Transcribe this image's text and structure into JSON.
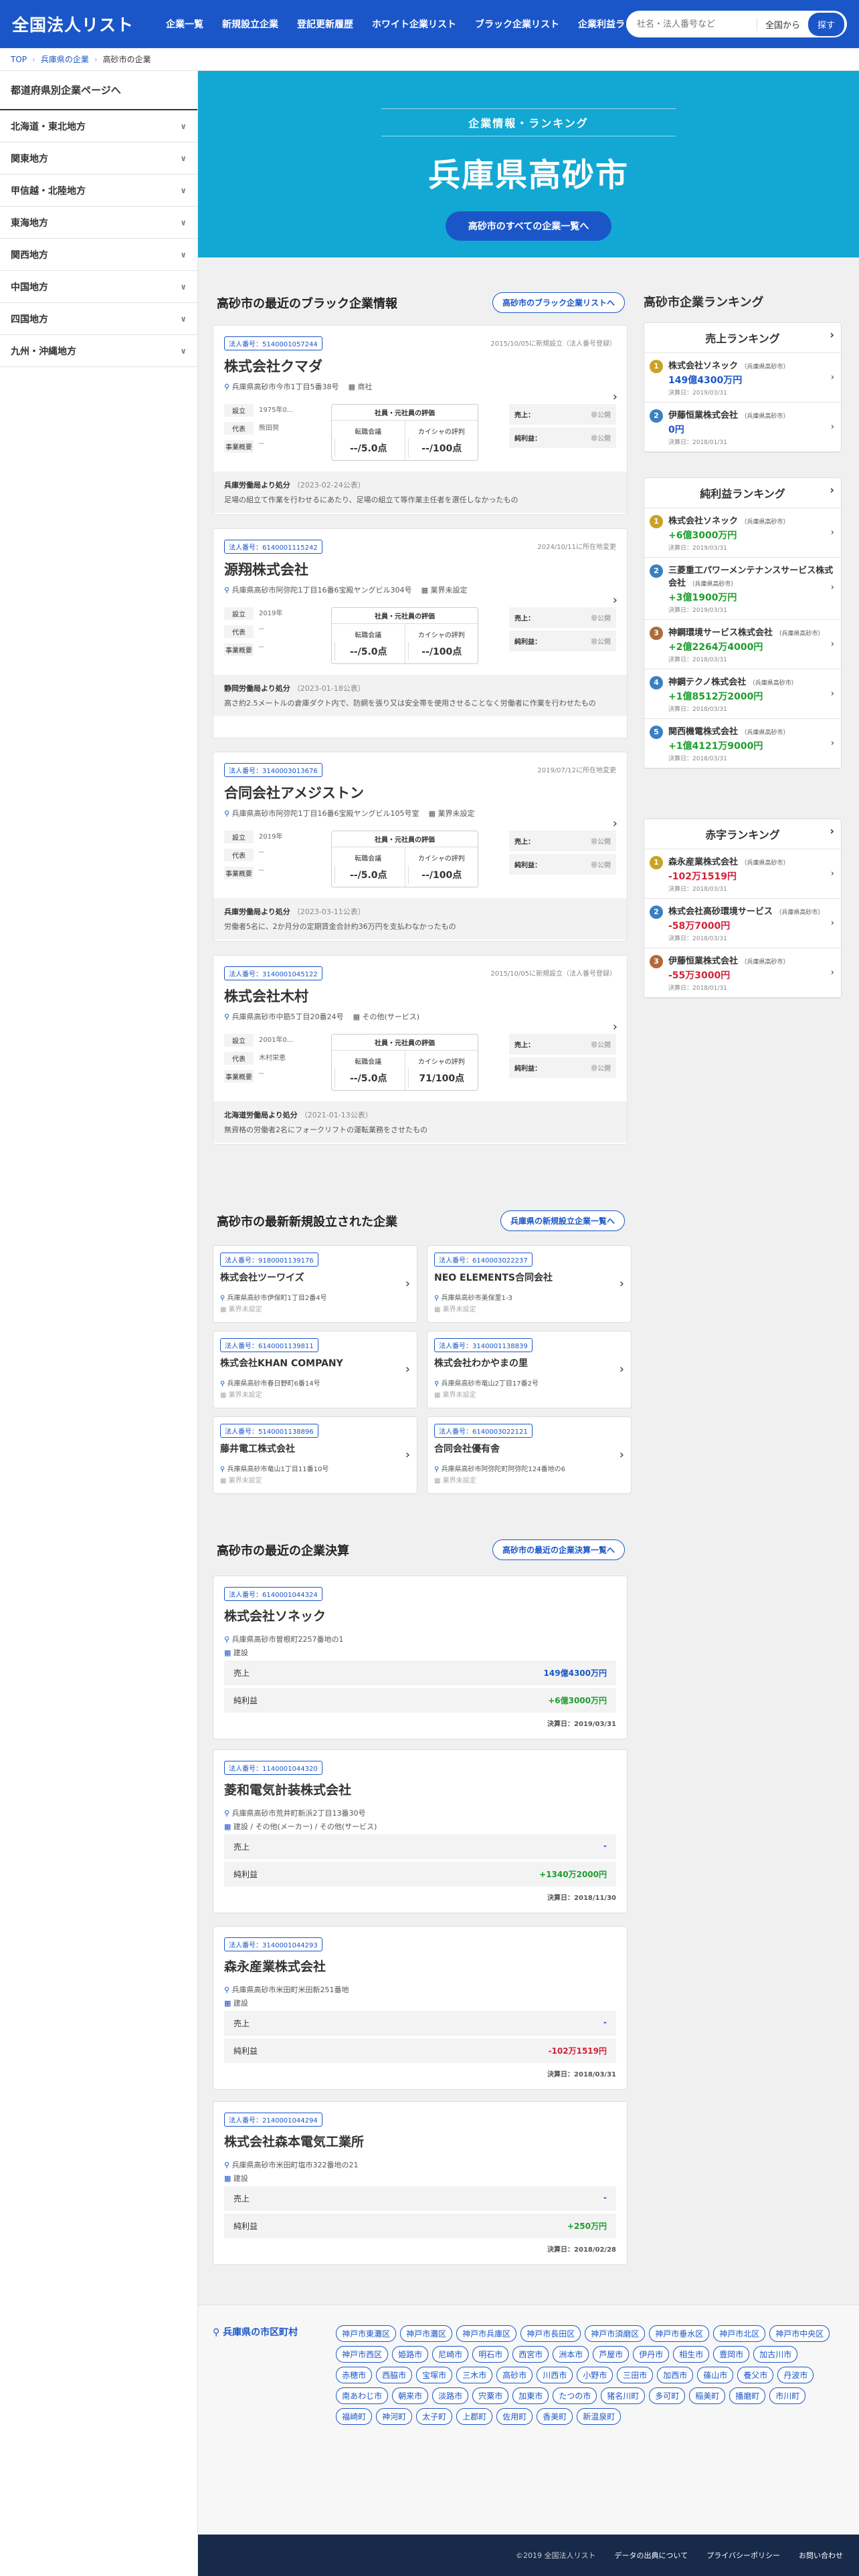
{
  "header": {
    "logo": "全国法人リスト",
    "nav": [
      "企業一覧",
      "新規設立企業",
      "登記更新履歴",
      "ホワイト企業リスト",
      "ブラック企業リスト",
      "企業利益ランキング"
    ],
    "search_placeholder": "社名・法人番号など",
    "search_scope": "全国から",
    "search_button": "探す"
  },
  "breadcrumb": [
    "TOP",
    "兵庫県の企業",
    "高砂市の企業"
  ],
  "sidebar": {
    "title": "都道府県別企業ページへ",
    "regions": [
      "北海道・東北地方",
      "関東地方",
      "甲信越・北陸地方",
      "東海地方",
      "関西地方",
      "中国地方",
      "四国地方",
      "九州・沖縄地方"
    ]
  },
  "hero": {
    "sub": "企業情報・ランキング",
    "title": "兵庫県高砂市",
    "button": "高砂市のすべての企業一覧へ"
  },
  "black": {
    "title": "高砂市の最近のブラック企業情報",
    "link": "高砂市のブラック企業リストへ",
    "labels": {
      "est": "設立",
      "rep": "代表",
      "biz": "事業概要",
      "eval": "社員・元社員の評価",
      "site1": "転職会議",
      "site2": "カイシャの評判",
      "sales": "売上：",
      "profit": "純利益：",
      "undisclosed": "非公開",
      "from": "より処分"
    },
    "items": [
      {
        "num": "法人番号：5140001057244",
        "date": "2015/10/05に新規設立（法人番号登録）",
        "name": "株式会社クマダ",
        "addr": "兵庫県高砂市今市1丁目5番38号",
        "ind": "商社",
        "est": "1975年0...",
        "rep": "熊田努",
        "biz": "--",
        "s1": "--/5.0点",
        "s2": "--/100点",
        "office": "兵庫労働局",
        "odate": "（2023-02-24公表）",
        "text": "足場の組立て作業を行わせるにあたり、足場の組立て等作業主任者を選任しなかったもの"
      },
      {
        "num": "法人番号：6140001115242",
        "date": "2024/10/11に所在地変更",
        "name": "源翔株式会社",
        "addr": "兵庫県高砂市阿弥陀1丁目16番6宝殿ヤングビル304号",
        "ind": "業界未設定",
        "est": "2019年",
        "rep": "--",
        "biz": "--",
        "s1": "--/5.0点",
        "s2": "--/100点",
        "office": "静岡労働局",
        "odate": "（2023-01-18公表）",
        "text": "高さ約2.5メートルの倉庫ダクト内で、防網を張り又は安全帯を使用させることなく労働者に作業を行わせたもの"
      },
      {
        "num": "法人番号：3140003013676",
        "date": "2019/07/12に所在地変更",
        "name": "合同会社アメジストン",
        "addr": "兵庫県高砂市阿弥陀1丁目16番6宝殿ヤングビル105号室",
        "ind": "業界未設定",
        "est": "2019年",
        "rep": "--",
        "biz": "--",
        "s1": "--/5.0点",
        "s2": "--/100点",
        "office": "兵庫労働局",
        "odate": "（2023-03-11公表）",
        "text": "労働者5名に、2か月分の定期賃金合計約36万円を支払わなかったもの"
      },
      {
        "num": "法人番号：3140001045122",
        "date": "2015/10/05に新規設立（法人番号登録）",
        "name": "株式会社木村",
        "addr": "兵庫県高砂市中筋5丁目20番24号",
        "ind": "その他(サービス)",
        "est": "2001年0...",
        "rep": "木村栄恵",
        "biz": "--",
        "s1": "--/5.0点",
        "s2": "71/100点",
        "office": "北海道労働局",
        "odate": "（2021-01-13公表）",
        "text": "無資格の労働者2名にフォークリフトの運転業務をさせたもの"
      }
    ]
  },
  "new": {
    "title": "高砂市の最新新規設立された企業",
    "link": "兵庫県の新規設立企業一覧へ",
    "items": [
      {
        "num": "法人番号：9180001139176",
        "name": "株式会社ツーワイズ",
        "addr": "兵庫県高砂市伊保町1丁目2番4号",
        "ind": "業界未設定"
      },
      {
        "num": "法人番号：6140003022237",
        "name": "NEO ELEMENTS合同会社",
        "addr": "兵庫県高砂市美保里1-3",
        "ind": "業界未設定"
      },
      {
        "num": "法人番号：6140001139811",
        "name": "株式会社KHAN COMPANY",
        "addr": "兵庫県高砂市春日野町6番14号",
        "ind": "業界未設定"
      },
      {
        "num": "法人番号：3140001138839",
        "name": "株式会社わかやまの里",
        "addr": "兵庫県高砂市竜山2丁目17番2号",
        "ind": "業界未設定"
      },
      {
        "num": "法人番号：5140001138896",
        "name": "藤井電工株式会社",
        "addr": "兵庫県高砂市竜山1丁目11番10号",
        "ind": "業界未設定"
      },
      {
        "num": "法人番号：6140003022121",
        "name": "合同会社優有舎",
        "addr": "兵庫県高砂市阿弥陀町阿弥陀124番地の6",
        "ind": "業界未設定"
      }
    ]
  },
  "fin": {
    "title": "高砂市の最近の企業決算",
    "link": "高砂市の最近の企業決算一覧へ",
    "labels": {
      "sales": "売上",
      "profit": "純利益"
    },
    "items": [
      {
        "num": "法人番号：6140001044324",
        "name": "株式会社ソネック",
        "addr": "兵庫県高砂市曽根町2257番地の1",
        "ind": "建設",
        "sales": "149億4300万円",
        "profit": "+6億3000万円",
        "date": "決算日：2019/03/31",
        "pc": "green"
      },
      {
        "num": "法人番号：1140001044320",
        "name": "菱和電気計装株式会社",
        "addr": "兵庫県高砂市荒井町新浜2丁目13番30号",
        "ind": "建設 / その他(メーカー) / その他(サービス)",
        "sales": "-",
        "profit": "+1340万2000円",
        "date": "決算日：2018/11/30",
        "pc": "green"
      },
      {
        "num": "法人番号：3140001044293",
        "name": "森永産業株式会社",
        "addr": "兵庫県高砂市米田町米田新251番地",
        "ind": "建設",
        "sales": "-",
        "profit": "-102万1519円",
        "date": "決算日：2018/03/31",
        "pc": "red"
      },
      {
        "num": "法人番号：2140001044294",
        "name": "株式会社森本電気工業所",
        "addr": "兵庫県高砂市米田町塩市322番地の21",
        "ind": "建設",
        "sales": "-",
        "profit": "+250万円",
        "date": "決算日：2018/02/28",
        "pc": "green"
      }
    ]
  },
  "ranking": {
    "title": "高砂市企業ランキング",
    "boxes": [
      {
        "title": "売上ランキング",
        "items": [
          {
            "n": "1",
            "name": "株式会社ソネック",
            "pref": "（兵庫県高砂市）",
            "val": "149億4300万円",
            "date": "決算日：2019/03/31",
            "c": "blue"
          },
          {
            "n": "2",
            "name": "伊藤恒業株式会社",
            "pref": "（兵庫県高砂市）",
            "val": "0円",
            "date": "決算日：2018/01/31",
            "c": "blue"
          }
        ]
      },
      {
        "title": "純利益ランキング",
        "items": [
          {
            "n": "1",
            "name": "株式会社ソネック",
            "pref": "（兵庫県高砂市）",
            "val": "+6億3000万円",
            "date": "決算日：2019/03/31",
            "c": "green"
          },
          {
            "n": "2",
            "name": "三菱重工パワーメンテナンスサービス株式会社",
            "pref": "（兵庫県高砂市）",
            "val": "+3億1900万円",
            "date": "決算日：2019/03/31",
            "c": "green"
          },
          {
            "n": "3",
            "name": "神鋼環境サービス株式会社",
            "pref": "（兵庫県高砂市）",
            "val": "+2億2264万4000円",
            "date": "決算日：2018/03/31",
            "c": "green"
          },
          {
            "n": "4",
            "name": "神鋼テクノ株式会社",
            "pref": "（兵庫県高砂市）",
            "val": "+1億8512万2000円",
            "date": "決算日：2018/03/31",
            "c": "green"
          },
          {
            "n": "5",
            "name": "関西機電株式会社",
            "pref": "（兵庫県高砂市）",
            "val": "+1億4121万9000円",
            "date": "決算日：2018/03/31",
            "c": "green"
          }
        ]
      },
      {
        "title": "赤字ランキング",
        "items": [
          {
            "n": "1",
            "name": "森永産業株式会社",
            "pref": "（兵庫県高砂市）",
            "val": "-102万1519円",
            "date": "決算日：2018/03/31",
            "c": "red"
          },
          {
            "n": "2",
            "name": "株式会社高砂環境サービス",
            "pref": "（兵庫県高砂市）",
            "val": "-58万7000円",
            "date": "決算日：2018/03/31",
            "c": "red"
          },
          {
            "n": "3",
            "name": "伊藤恒業株式会社",
            "pref": "（兵庫県高砂市）",
            "val": "-55万3000円",
            "date": "決算日：2018/01/31",
            "c": "red"
          }
        ]
      }
    ]
  },
  "muni": {
    "title": "兵庫県の市区町村",
    "tags": [
      "神戸市東灘区",
      "神戸市灘区",
      "神戸市兵庫区",
      "神戸市長田区",
      "神戸市須磨区",
      "神戸市垂水区",
      "神戸市北区",
      "神戸市中央区",
      "神戸市西区",
      "姫路市",
      "尼崎市",
      "明石市",
      "西宮市",
      "洲本市",
      "芦屋市",
      "伊丹市",
      "相生市",
      "豊岡市",
      "加古川市",
      "赤穂市",
      "西脇市",
      "宝塚市",
      "三木市",
      "高砂市",
      "川西市",
      "小野市",
      "三田市",
      "加西市",
      "篠山市",
      "養父市",
      "丹波市",
      "南あわじ市",
      "朝来市",
      "淡路市",
      "宍粟市",
      "加東市",
      "たつの市",
      "猪名川町",
      "多可町",
      "稲美町",
      "播磨町",
      "市川町",
      "福崎町",
      "神河町",
      "太子町",
      "上郡町",
      "佐用町",
      "香美町",
      "新温泉町"
    ]
  },
  "footer": {
    "copy": "©2019 全国法人リスト",
    "links": [
      "データの出典について",
      "プライバシーポリシー",
      "お問い合わせ"
    ]
  },
  "colors": {
    "brand": "#1b56c9",
    "hero": "#12a8d3",
    "footer": "#172a4a"
  }
}
